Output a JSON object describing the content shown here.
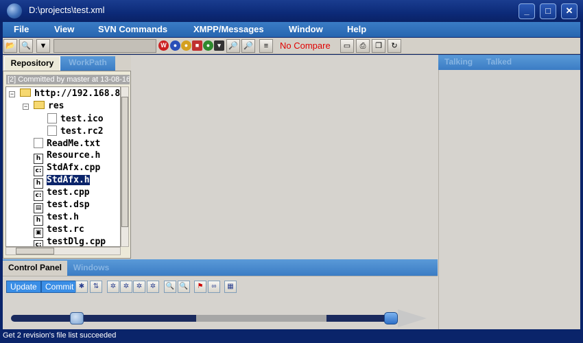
{
  "window": {
    "title": "D:\\projects\\test.xml",
    "buttons": [
      "_",
      "□",
      "✕"
    ]
  },
  "menu": [
    "File",
    "View",
    "SVN Commands",
    "XMPP/Messages",
    "Window",
    "Help"
  ],
  "toolbar": {
    "status": "No Compare"
  },
  "repository": {
    "tabs": [
      "Repository",
      "WorkPath"
    ],
    "commit_line": "[2] Committed by master at 13-08-16",
    "tree": [
      {
        "name": "http://192.168.8",
        "kind": "folder",
        "depth": 0,
        "expanded": true
      },
      {
        "name": "res",
        "kind": "folder",
        "depth": 1,
        "expanded": true
      },
      {
        "name": "test.ico",
        "kind": "file",
        "depth": 2
      },
      {
        "name": "test.rc2",
        "kind": "file",
        "depth": 2
      },
      {
        "name": "ReadMe.txt",
        "kind": "file",
        "depth": 1
      },
      {
        "name": "Resource.h",
        "kind": "header",
        "depth": 1
      },
      {
        "name": "StdAfx.cpp",
        "kind": "source",
        "depth": 1
      },
      {
        "name": "StdAfx.h",
        "kind": "header",
        "depth": 1,
        "selected": true
      },
      {
        "name": "test.cpp",
        "kind": "source",
        "depth": 1
      },
      {
        "name": "test.dsp",
        "kind": "project",
        "depth": 1
      },
      {
        "name": "test.h",
        "kind": "header",
        "depth": 1
      },
      {
        "name": "test.rc",
        "kind": "resource",
        "depth": 1
      },
      {
        "name": "testDlg.cpp",
        "kind": "source",
        "depth": 1
      }
    ]
  },
  "right_panel": {
    "tabs": [
      "Talking",
      "Talked"
    ]
  },
  "control_panel": {
    "tabs": [
      "Control Panel",
      "Windows"
    ],
    "buttons": [
      "Update",
      "Commit"
    ],
    "progress": {
      "start_fraction": 0.17,
      "range_start": 0.5,
      "range_end": 0.84
    }
  },
  "status_bar": {
    "text": "Get 2 revision's file list succeeded"
  }
}
